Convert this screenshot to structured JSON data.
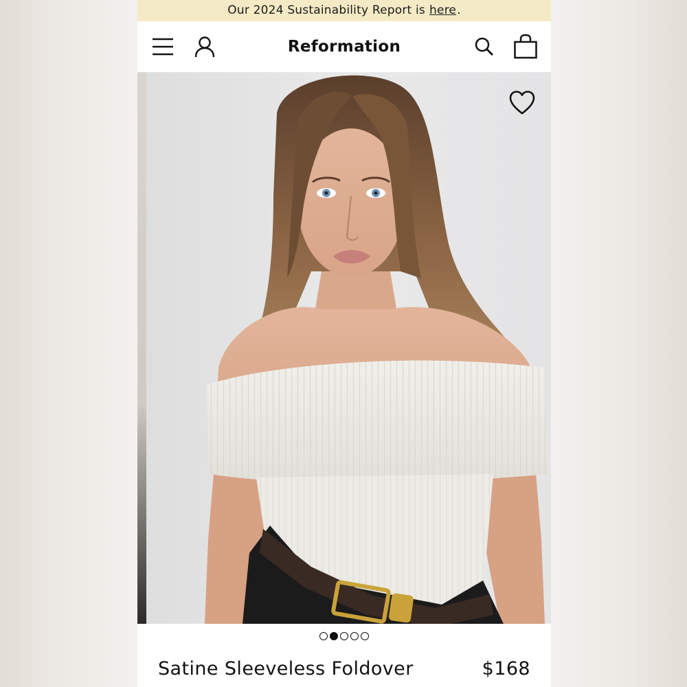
{
  "promo": {
    "text": "Our 2024 Sustainability Report is",
    "link": "here",
    "period": "."
  },
  "header": {
    "brand": "Reformation",
    "icons": [
      "menu-icon",
      "account-icon",
      "search-icon",
      "bag-icon"
    ]
  },
  "gallery": {
    "image_subject": "woman wearing white off-shoulder foldover knit top with black pants and belt",
    "total_slides": 5,
    "active_slide": 2
  },
  "product": {
    "name": "Satine Sleeveless Foldover",
    "price": "$168"
  },
  "colors": {
    "promo_bg": "#f4ebc6",
    "text": "#111111"
  }
}
